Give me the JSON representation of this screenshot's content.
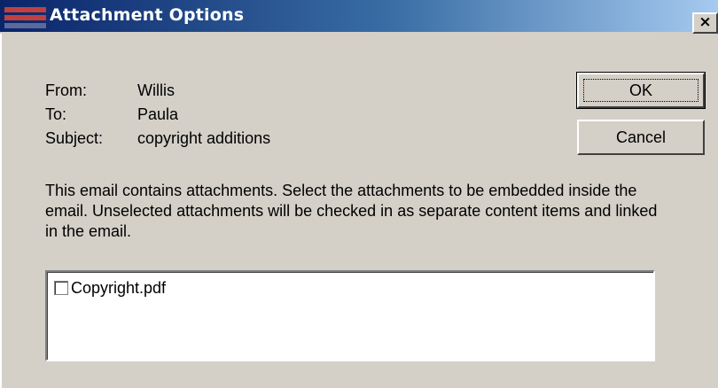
{
  "window": {
    "title": "Attachment Options",
    "close_glyph": "×"
  },
  "header": {
    "from_label": "From:",
    "from_value": "Willis",
    "to_label": "To:",
    "to_value": "Paula",
    "subject_label": "Subject:",
    "subject_value": "copyright additions"
  },
  "buttons": {
    "ok_label": "OK",
    "cancel_label": "Cancel"
  },
  "description": "This email contains attachments. Select the attachments to be embedded inside the email. Unselected attachments will be checked in as separate content items and linked in the email.",
  "attachments": [
    {
      "name": "Copyright.pdf",
      "checked": false
    }
  ],
  "colors": {
    "titlebar_start": "#0a246a",
    "titlebar_end": "#a6caf0",
    "dialog_bg": "#d4d0c8"
  }
}
